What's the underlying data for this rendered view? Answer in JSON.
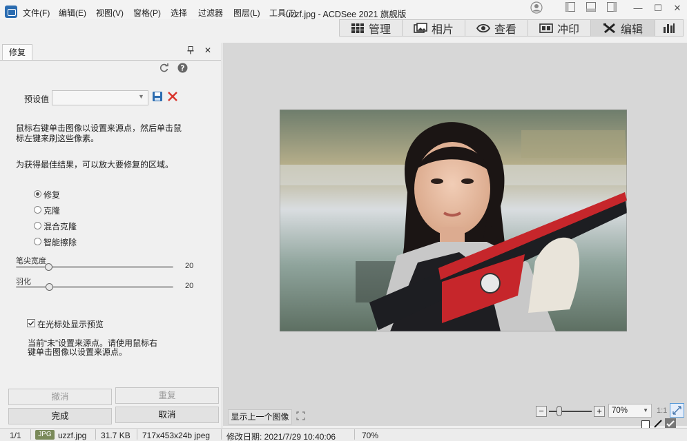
{
  "app": {
    "title": "uzzf.jpg - ACDSee 2021 旗舰版"
  },
  "menu": {
    "items": [
      "文件(F)",
      "编辑(E)",
      "视图(V)",
      "窗格(P)",
      "选择",
      "过滤器",
      "图层(L)",
      "工具(T)"
    ]
  },
  "modes": [
    {
      "label": "管理",
      "icon": "grid-icon"
    },
    {
      "label": "相片",
      "icon": "photos-icon"
    },
    {
      "label": "查看",
      "icon": "eye-icon"
    },
    {
      "label": "冲印",
      "icon": "develop-icon"
    },
    {
      "label": "编辑",
      "icon": "edit-tools-icon"
    },
    {
      "label": "",
      "icon": "bar-chart-icon"
    }
  ],
  "panel": {
    "tab": "修复",
    "pin": "📌",
    "close": "✕",
    "preset_label": "预设值",
    "instruction1": "鼠标右键单击图像以设置来源点，然后单击鼠标左键来刷这些像素。",
    "instruction1_a": "鼠标右键单击图像以设置来源点，然后单击鼠",
    "instruction1_b": "标左键来刷这些像素。",
    "instruction2": "为获得最佳结果，可以放大要修复的区域。",
    "modes": [
      "修复",
      "克隆",
      "混合克隆",
      "智能擦除"
    ],
    "selected_mode": "修复",
    "brush_width_label": "笔尖宽度",
    "brush_width_value": "20",
    "feather_label": "羽化",
    "feather_value": "20",
    "preview_checkbox": "在光标处显示预览",
    "status_a": "当前“未”设置来源点。请使用鼠标右",
    "status_b": "键单击图像以设置来源点。",
    "undo": "撤消",
    "redo": "重复",
    "done": "完成",
    "cancel": "取消"
  },
  "viewer": {
    "show_prev": "显示上一个图像",
    "zoom_value": "70%",
    "zoom_1to1": "1:1"
  },
  "status": {
    "page": "1/1",
    "format_badge": "JPG",
    "filename": "uzzf.jpg",
    "size": "31.7 KB",
    "dims": "717x453x24b jpeg",
    "modified": "修改日期: 2021/7/29 10:40:06",
    "zoom": "70%"
  },
  "colors": {
    "accent": "#2b6cb0",
    "delete": "#d9342b",
    "save": "#2b6cb0"
  }
}
